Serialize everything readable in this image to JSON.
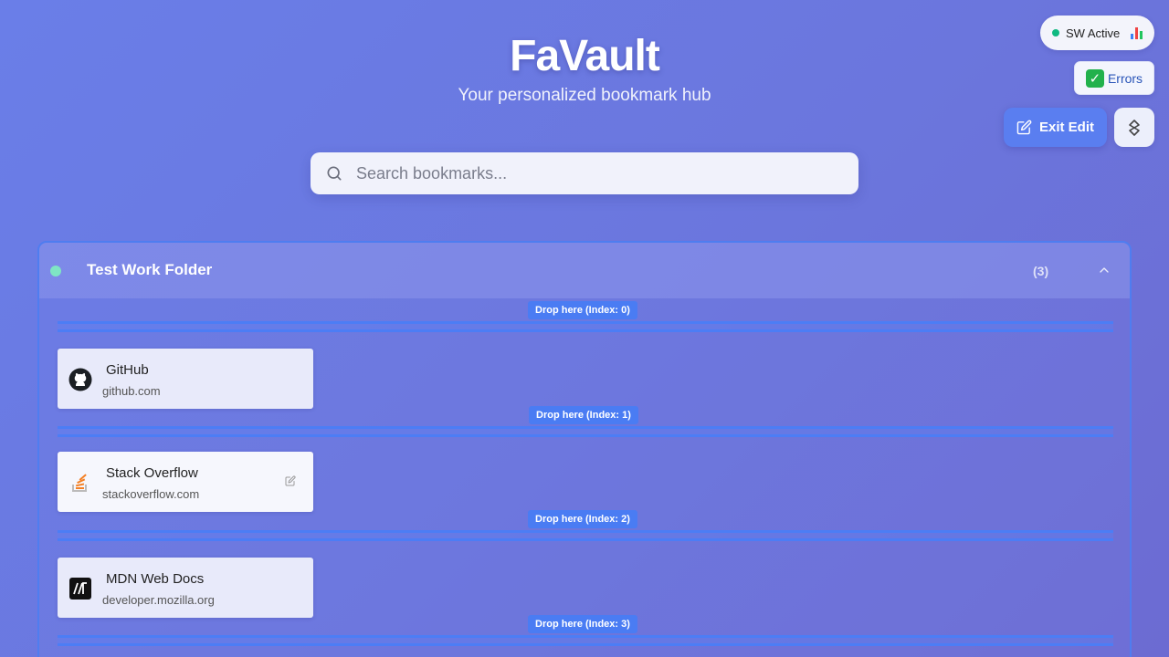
{
  "app": {
    "title": "FaVault",
    "subtitle": "Your personalized bookmark hub"
  },
  "status": {
    "sw_label": "SW Active",
    "sw_color": "#10b981",
    "errors_label": "Errors"
  },
  "toolbar": {
    "exit_edit_label": "Exit Edit"
  },
  "search": {
    "placeholder": "Search bookmarks..."
  },
  "folder": {
    "name": "Test Work Folder",
    "count": "(3)",
    "color": "#7fe5c4",
    "bookmarks": [
      {
        "title": "GitHub",
        "url": "github.com",
        "icon": "github-icon"
      },
      {
        "title": "Stack Overflow",
        "url": "stackoverflow.com",
        "icon": "stackoverflow-icon"
      },
      {
        "title": "MDN Web Docs",
        "url": "developer.mozilla.org",
        "icon": "mdn-icon"
      }
    ],
    "drop_zones": [
      "Drop here (Index: 0)",
      "Drop here (Index: 1)",
      "Drop here (Index: 2)",
      "Drop here (Index: 3)"
    ]
  },
  "colors": {
    "accent": "#5a7ef0",
    "drop_zone": "#4a7cf3"
  }
}
